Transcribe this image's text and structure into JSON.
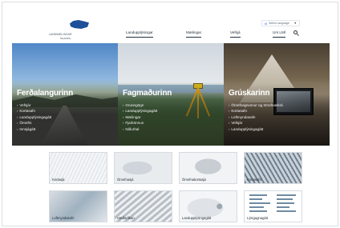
{
  "header": {
    "logo": {
      "line1": "LANDMÆLINGAR",
      "line2": "ÍSLANDS",
      "icon": "iceland-map-icon"
    },
    "language": {
      "g": "G",
      "label": "Select Language",
      "caret": "▼"
    },
    "nav": [
      {
        "label": "Landupplýsingar"
      },
      {
        "label": "Mælingar"
      },
      {
        "label": "Vefsjá"
      },
      {
        "label": "Um LMÍ"
      }
    ],
    "search_icon": "search-icon"
  },
  "hero": {
    "panels": [
      {
        "title": "Ferðalangurinn",
        "links": [
          "Vefsjár",
          "Kortasafn",
          "Landupplýsingagátt",
          "Örnefni",
          "Innsjágátt"
        ]
      },
      {
        "title": "Fagmaðurinn",
        "links": [
          "Grunngögn",
          "Landupplýsingagátt",
          "Mælingar",
          "Fjarkönnun",
          "Niðurhal"
        ]
      },
      {
        "title": "Grúskarinn",
        "links": [
          "Örnefnagrunnur og örnefnaskrá",
          "Kortasafn",
          "Loftmyndasafn",
          "Vefsjár",
          "Landupplýsingagátt"
        ]
      }
    ]
  },
  "thumbnails": [
    {
      "label": "Kortasjá"
    },
    {
      "label": "Örnefnasjá"
    },
    {
      "label": "Örnefnakortasjá"
    },
    {
      "label": "Kortasafn"
    },
    {
      "label": "Loftmyndasafn"
    },
    {
      "label": "Hæðarlíkan"
    },
    {
      "label": "Landupplýsingagátt"
    },
    {
      "label": "Lýsigagnagátt"
    }
  ],
  "colors": {
    "nav_text": "#23313f",
    "logo_blue": "#1d4f9a",
    "hero_title": "#ffffff"
  }
}
